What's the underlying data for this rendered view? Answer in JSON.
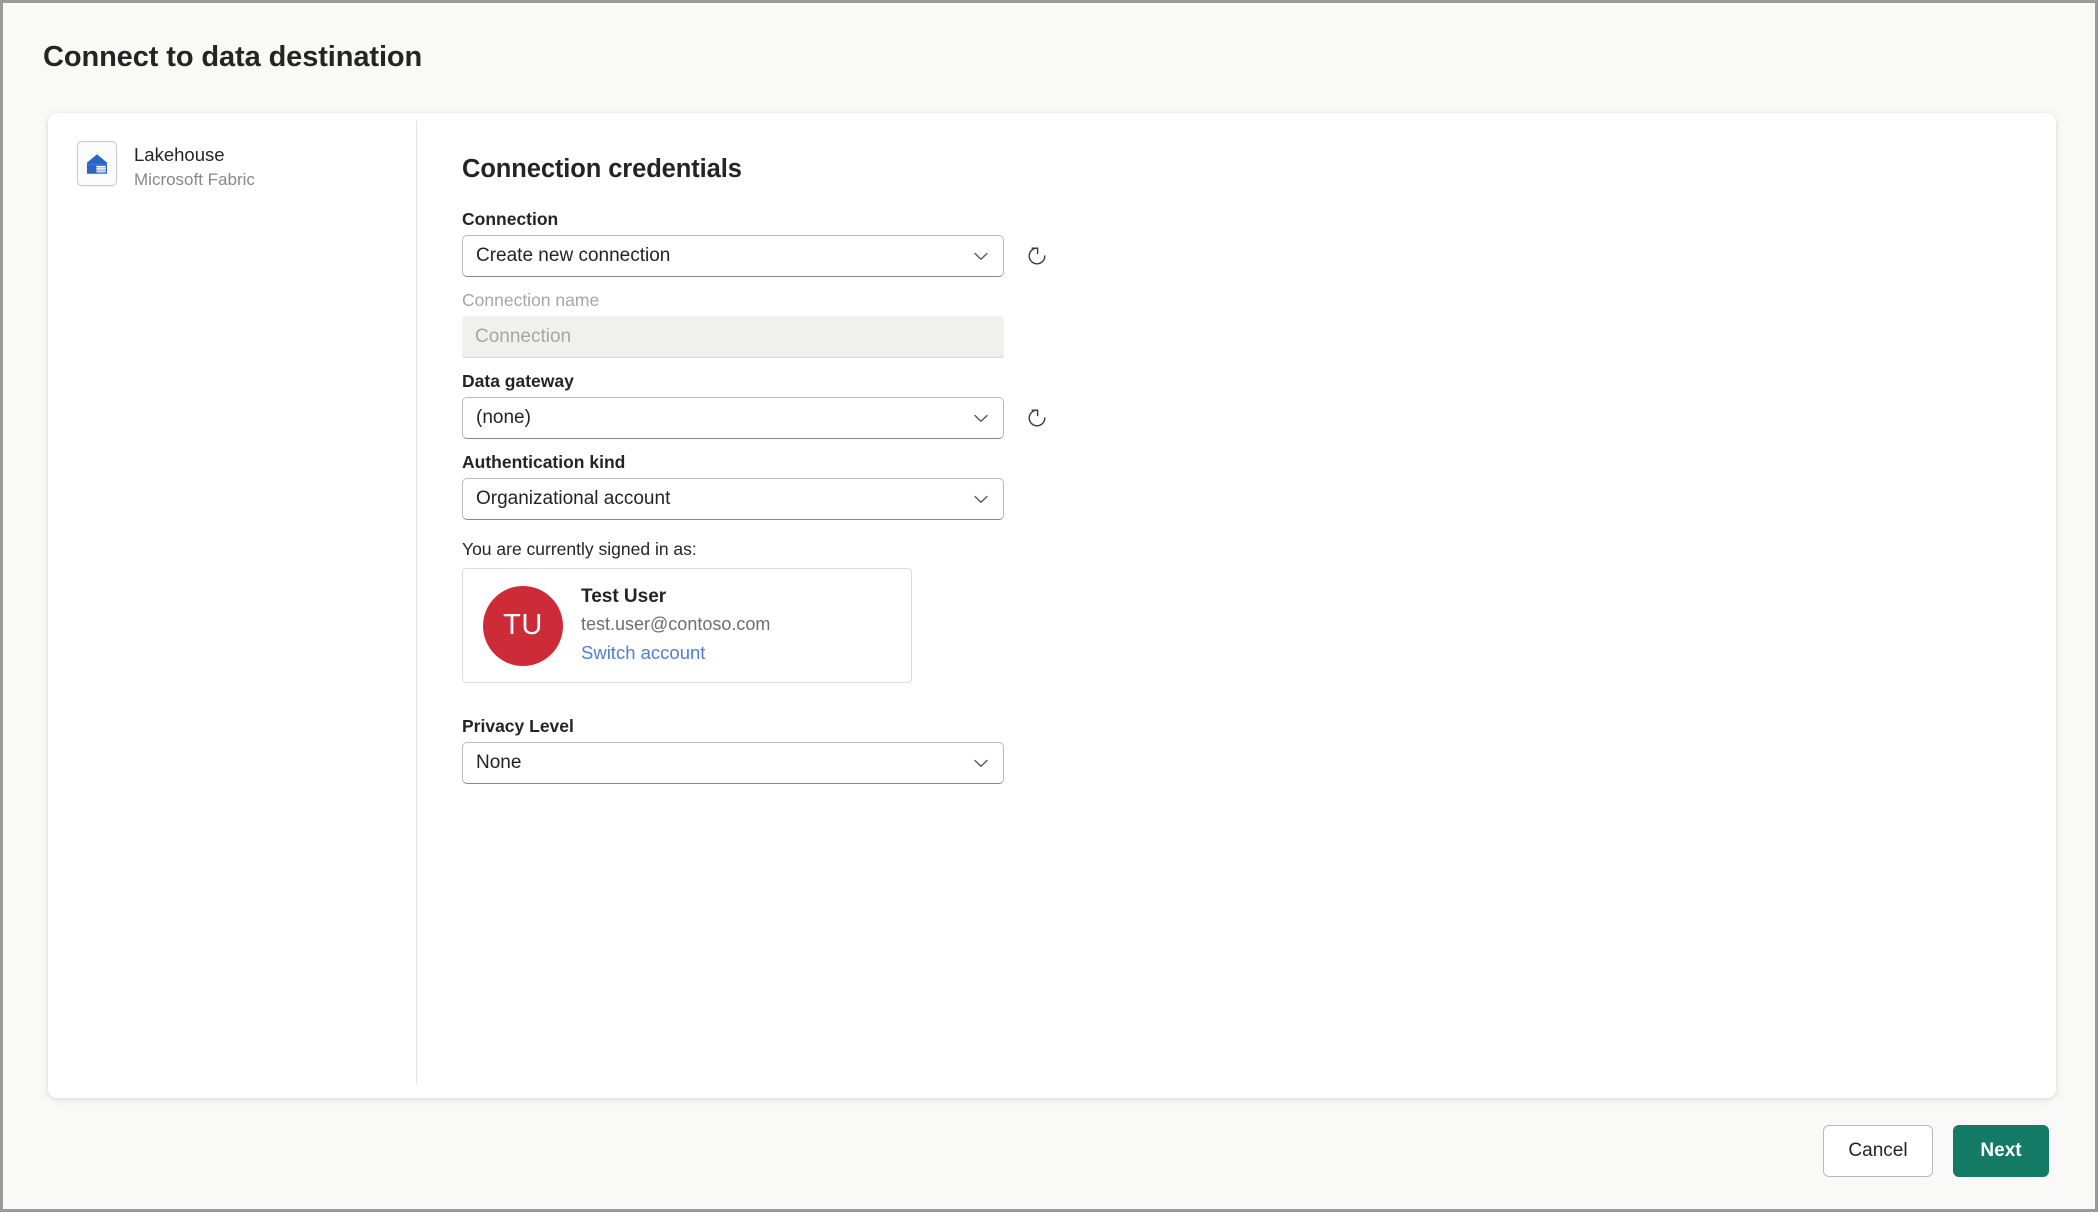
{
  "header": {
    "title": "Connect to data destination"
  },
  "source": {
    "name": "Lakehouse",
    "subtitle": "Microsoft Fabric",
    "icon": "lakehouse-icon"
  },
  "form": {
    "heading": "Connection credentials",
    "connection": {
      "label": "Connection",
      "value": "Create new connection",
      "refresh_icon": "refresh-icon",
      "chevron_icon": "chevron-down-icon"
    },
    "connection_name": {
      "label": "Connection name",
      "placeholder": "Connection",
      "value": "",
      "disabled": true
    },
    "data_gateway": {
      "label": "Data gateway",
      "value": "(none)",
      "refresh_icon": "refresh-icon",
      "chevron_icon": "chevron-down-icon"
    },
    "authentication_kind": {
      "label": "Authentication kind",
      "value": "Organizational account",
      "chevron_icon": "chevron-down-icon"
    },
    "signed_in": {
      "label": "You are currently signed in as:",
      "initials": "TU",
      "name": "Test User",
      "email": "test.user@contoso.com",
      "switch_link": "Switch account",
      "avatar_color": "#cc2b37",
      "link_color": "#4f7fd4"
    },
    "privacy_level": {
      "label": "Privacy Level",
      "value": "None",
      "chevron_icon": "chevron-down-icon"
    }
  },
  "footer": {
    "cancel_label": "Cancel",
    "next_label": "Next",
    "next_color": "#137a66"
  }
}
